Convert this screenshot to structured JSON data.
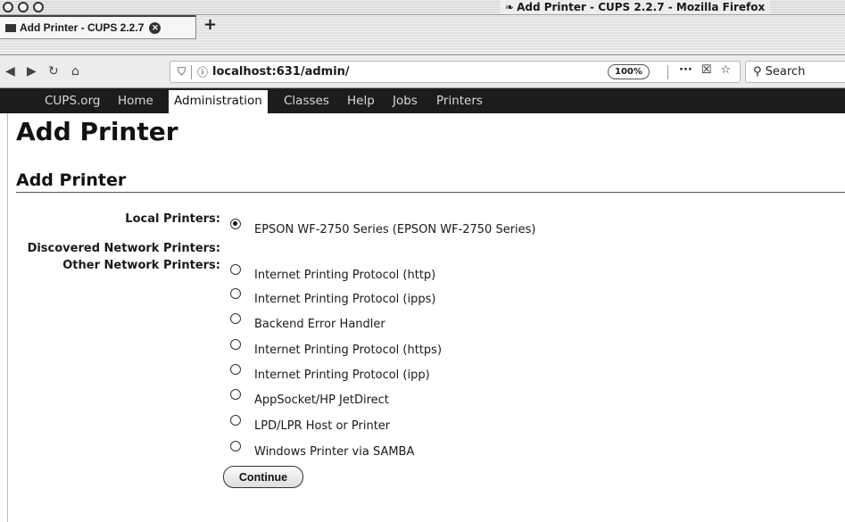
{
  "window": {
    "title": "Add Printer - CUPS 2.2.7 - Mozilla Firefox"
  },
  "tab": {
    "label": "Add Printer - CUPS 2.2.7",
    "new_tab": "+"
  },
  "urlbar": {
    "url": "localhost:631/admin/",
    "zoom": "100%",
    "more": "···"
  },
  "search": {
    "placeholder": "Search"
  },
  "cups_nav": {
    "items": [
      {
        "label": "CUPS.org"
      },
      {
        "label": "Home"
      },
      {
        "label": "Administration"
      },
      {
        "label": "Classes"
      },
      {
        "label": "Help"
      },
      {
        "label": "Jobs"
      },
      {
        "label": "Printers"
      }
    ],
    "active": "Administration"
  },
  "page": {
    "title": "Add Printer",
    "section_title": "Add Printer",
    "labels": {
      "local": "Local Printers:",
      "discovered": "Discovered Network Printers:",
      "other": "Other Network Printers:"
    },
    "local_printers": [
      {
        "label": "EPSON WF-2750 Series (EPSON WF-2750 Series)",
        "checked": true
      }
    ],
    "other_printers": [
      {
        "label": "Internet Printing Protocol (http)"
      },
      {
        "label": "Internet Printing Protocol (ipps)"
      },
      {
        "label": "Backend Error Handler"
      },
      {
        "label": "Internet Printing Protocol (https)"
      },
      {
        "label": "Internet Printing Protocol (ipp)"
      },
      {
        "label": "AppSocket/HP JetDirect"
      },
      {
        "label": "LPD/LPR Host or Printer"
      },
      {
        "label": "Windows Printer via SAMBA"
      }
    ],
    "continue_label": "Continue"
  }
}
